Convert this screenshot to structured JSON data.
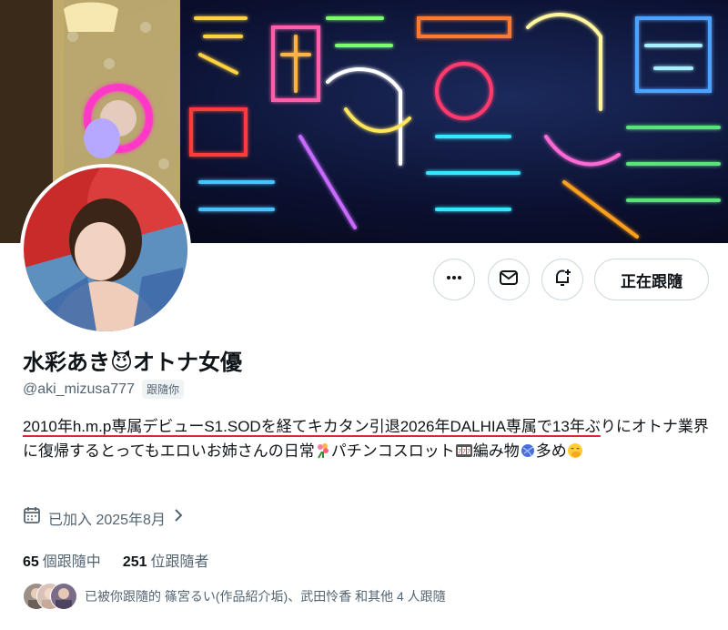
{
  "profile": {
    "display_name": "水彩あき😈オトナ女優",
    "handle": "@aki_mizusa777",
    "follows_you_badge": "跟隨你",
    "bio": {
      "highlight": "2010年h.m.p専属デビューS1.SODを経てキカタン引退2026年DALHIA専属で13年ぶ",
      "rest_1": "りにオトナ業界に復帰するとってもエロいお姉さんの日常",
      "rest_2": "パチンコスロット",
      "rest_3": "編み物",
      "rest_4": "多め"
    },
    "joined": "已加入 2025年8月",
    "following_count": "65",
    "following_label": "個跟隨中",
    "followers_count": "251",
    "followers_label": "位跟隨者",
    "mutual_text": "已被你跟隨的 篠宮るい(作品紹介垢)、武田怜香 和其他 4 人跟隨"
  },
  "actions": {
    "more_icon": "more-icon",
    "message_icon": "mail-icon",
    "notify_icon": "bell-plus-icon",
    "follow_label": "正在跟隨"
  },
  "colors": {
    "text_primary": "#0f1419",
    "text_secondary": "#536471",
    "border": "#cfd9de",
    "underline": "#e0242b"
  }
}
